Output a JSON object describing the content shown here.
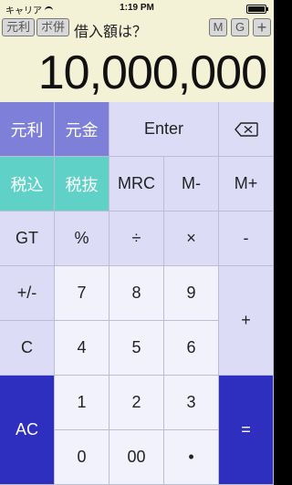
{
  "status_bar": {
    "carrier": "キャリア",
    "time": "1:19 PM",
    "battery_level": 1.0
  },
  "toolbar": {
    "left_buttons": [
      "元利",
      "ボ併"
    ],
    "prompt": "借入額は？",
    "right_buttons": [
      "M",
      "G",
      "+"
    ]
  },
  "display": {
    "value": "10,000,000"
  },
  "keypad": {
    "row1": [
      "元利",
      "元金",
      "Enter",
      "backspace-icon"
    ],
    "row2": [
      "税込",
      "税抜",
      "MRC",
      "M-",
      "M+"
    ],
    "row3": [
      "GT",
      "%",
      "÷",
      "×",
      "-"
    ],
    "row4": [
      "+/-",
      "7",
      "8",
      "9",
      "+"
    ],
    "row5": [
      "C",
      "4",
      "5",
      "6"
    ],
    "row6": [
      "AC",
      "1",
      "2",
      "3",
      "="
    ],
    "row7": [
      "0",
      "00",
      "•"
    ]
  },
  "colors": {
    "display_background": "#f3f1d6",
    "function_key": "#7d7fd9",
    "tax_key": "#5fd1c7",
    "operator_key": "#dcdcf6",
    "digit_key": "#f2f2fc",
    "accent_key": "#2f2fbf"
  }
}
